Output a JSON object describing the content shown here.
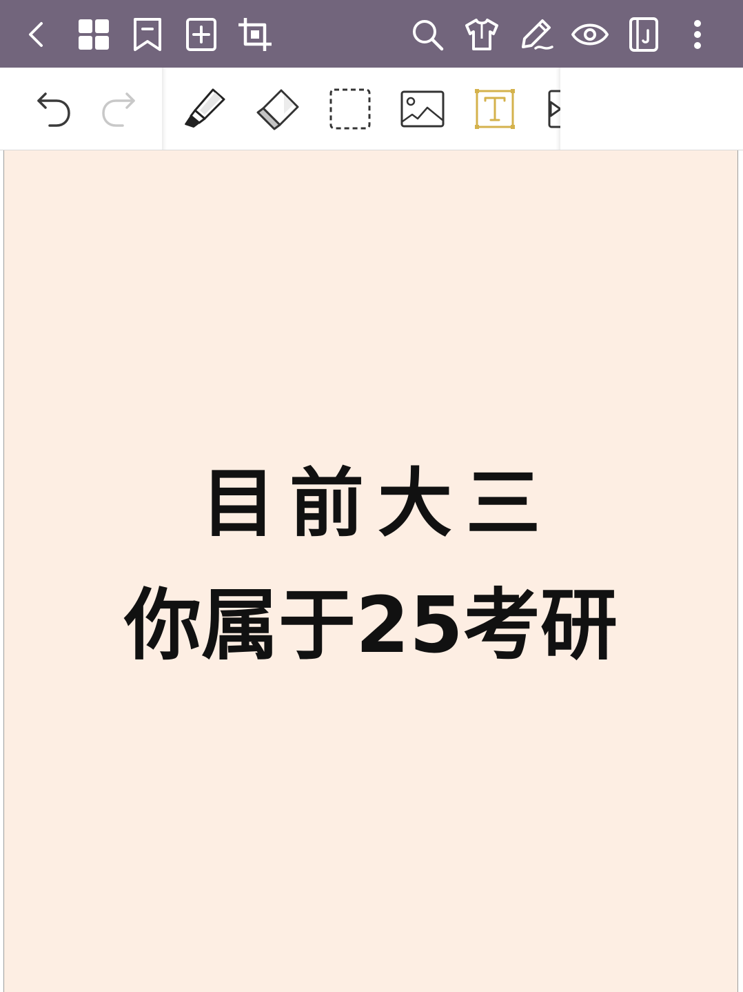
{
  "top_bar": {
    "background": "#72657c",
    "left_buttons": [
      "back-icon",
      "grid-icon",
      "bookmark-icon",
      "add-page-icon",
      "crop-icon"
    ],
    "right_buttons": [
      "search-icon",
      "shirt-icon",
      "pencil-icon",
      "eye-icon",
      "notebook-icon",
      "more-icon"
    ]
  },
  "toolbar": {
    "history": [
      "undo-icon",
      "redo-icon"
    ],
    "tools": [
      "highlighter-icon",
      "eraser-icon",
      "lasso-select-icon",
      "image-icon",
      "text-tool-icon",
      "media-icon"
    ],
    "active_tool": "text-tool-icon",
    "active_color": "#d4b24c"
  },
  "page": {
    "background": "#fdeee3",
    "line1": "目前大三",
    "line2": "你属于25考研"
  }
}
